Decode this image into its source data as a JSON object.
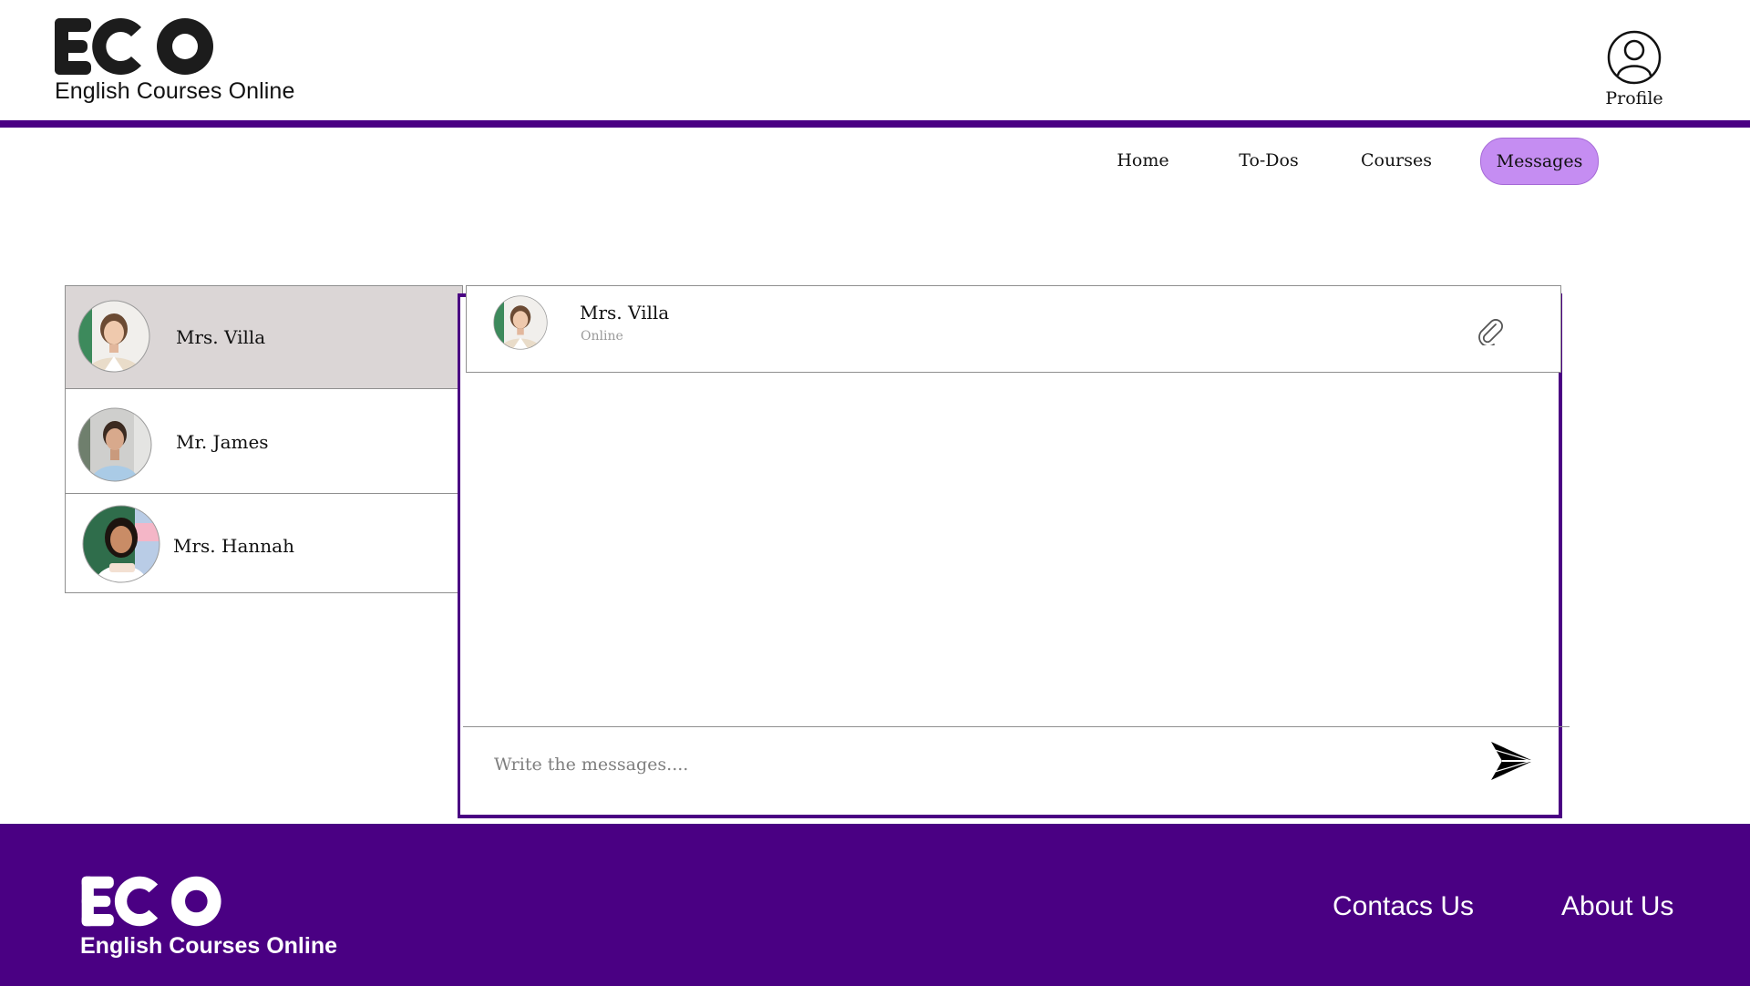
{
  "brand": {
    "logo_text": "ECO",
    "tagline": "English Courses Online",
    "colors": {
      "primary": "#4a0083",
      "nav_active": "#c58df2",
      "selected_row": "#dbd6d6"
    }
  },
  "header": {
    "profile_label": "Profile",
    "profile_icon": "user-circle-icon"
  },
  "nav": {
    "items": [
      {
        "label": "Home",
        "active": false
      },
      {
        "label": "To-Dos",
        "active": false
      },
      {
        "label": "Courses",
        "active": false
      },
      {
        "label": "Messages",
        "active": true
      }
    ]
  },
  "contacts": [
    {
      "name": "Mrs. Villa",
      "selected": true
    },
    {
      "name": "Mr. James",
      "selected": false
    },
    {
      "name": "Mrs. Hannah",
      "selected": false
    }
  ],
  "chat": {
    "contact_name": "Mrs. Villa",
    "status": "Online",
    "attach_icon": "paperclip-icon",
    "placeholder": "Write the messages....",
    "send_icon": "send-icon"
  },
  "footer": {
    "logo_text": "ECO",
    "tagline": "English Courses Online",
    "links": [
      "Contacs Us",
      "About Us"
    ]
  }
}
